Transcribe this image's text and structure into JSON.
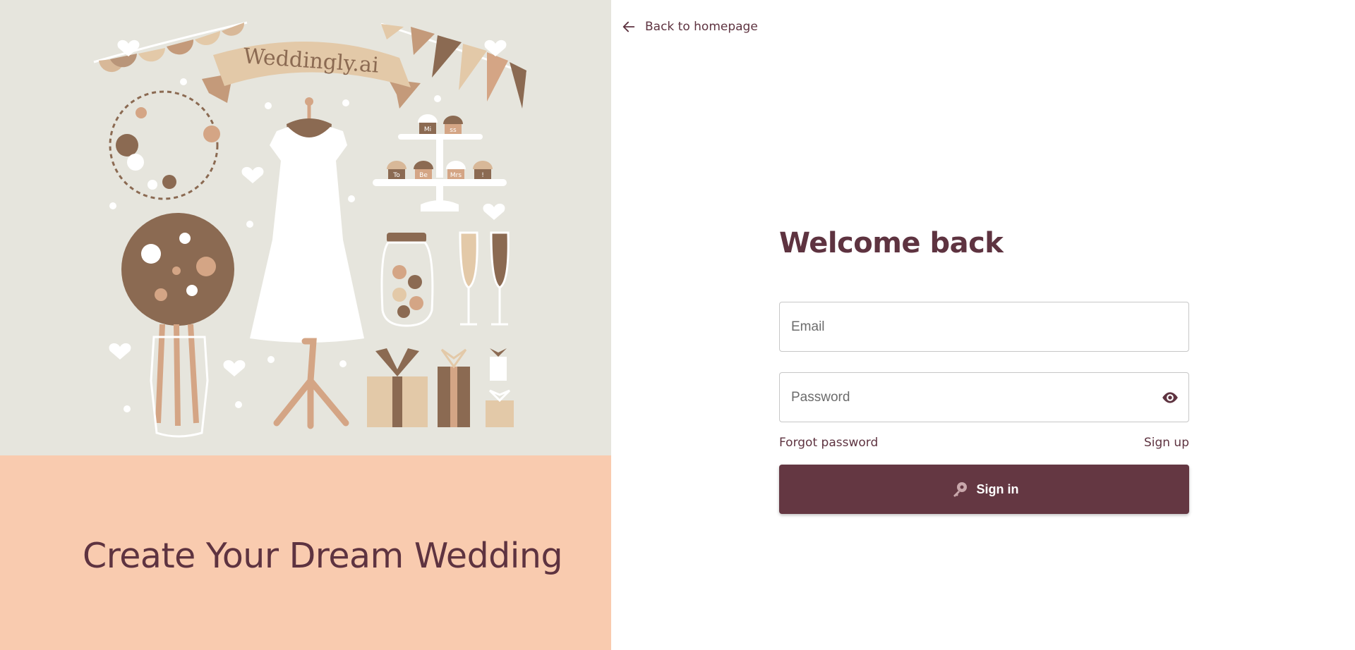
{
  "illustration": {
    "logo_text": "Weddingly.ai",
    "cupcake_labels": [
      "Mi",
      "ss",
      "To",
      "Be",
      "Mrs",
      "!"
    ]
  },
  "hero": {
    "tagline": "Create Your Dream Wedding"
  },
  "nav": {
    "back_label": "Back to homepage"
  },
  "form": {
    "title": "Welcome back",
    "email_placeholder": "Email",
    "password_placeholder": "Password",
    "forgot_label": "Forgot password",
    "signup_label": "Sign up",
    "signin_label": "Sign in"
  },
  "colors": {
    "primary": "#643742",
    "text": "#5e3340",
    "illustration_bg": "#e6e5dd",
    "peach": "#f9cbaf",
    "brown": "#8b6a52",
    "tan": "#d4a585",
    "cream": "#e3c9a8"
  }
}
